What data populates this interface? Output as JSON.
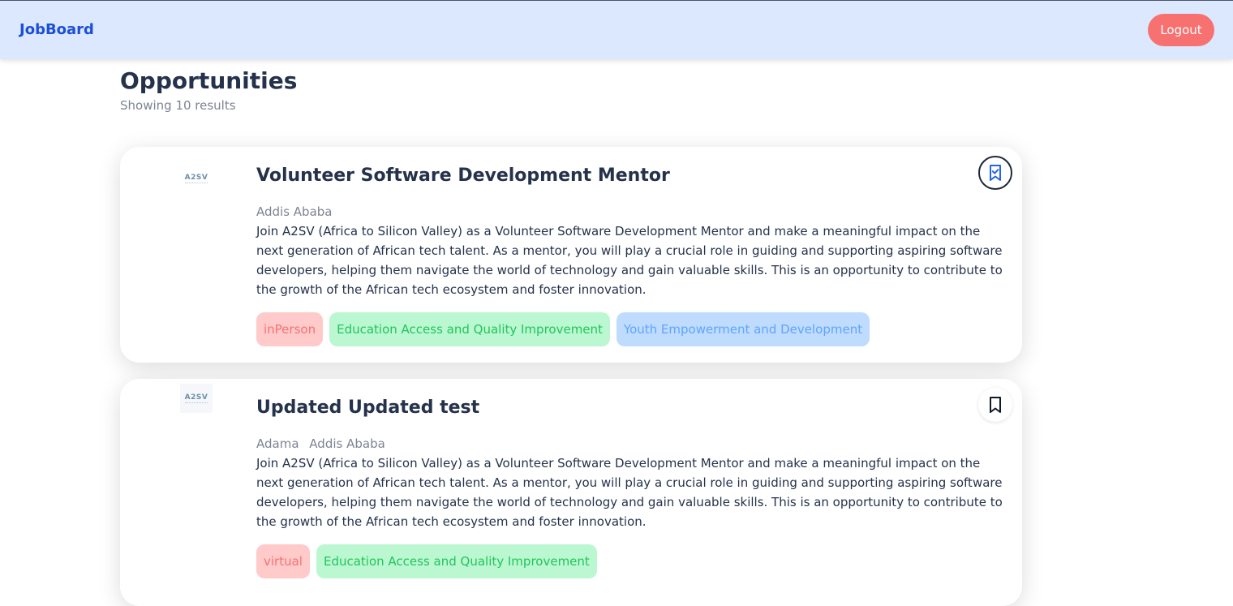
{
  "navbar": {
    "brand": "JobBoard",
    "logout_label": "Logout"
  },
  "page": {
    "title": "Opportunities",
    "result_count": "Showing 10 results"
  },
  "colors": {
    "navbar_bg": "#dbe8fe",
    "brand": "#1d4ed8",
    "logout_bg": "#f87171",
    "tag_red": "#f87171",
    "tag_green": "#22c55e",
    "tag_blue": "#60a5fa"
  },
  "jobs": [
    {
      "logo_text": "A2SV",
      "title": "Volunteer Software Development Mentor",
      "locations": [
        "Addis Ababa"
      ],
      "description": "Join A2SV (Africa to Silicon Valley) as a Volunteer Software Development Mentor and make a meaningful impact on the next generation of African tech talent. As a mentor, you will play a crucial role in guiding and supporting aspiring software developers, helping them navigate the world of technology and gain valuable skills. This is an opportunity to contribute to the growth of the African tech ecosystem and foster innovation.",
      "tags": [
        "inPerson",
        "Education Access and Quality Improvement",
        "Youth Empowerment and Development"
      ],
      "bookmark_icon": "bookmark-check-icon",
      "bookmarked": true
    },
    {
      "logo_text": "A2SV",
      "title": "Updated Updated test",
      "locations": [
        "Adama",
        "Addis Ababa"
      ],
      "description": "Join A2SV (Africa to Silicon Valley) as a Volunteer Software Development Mentor and make a meaningful impact on the next generation of African tech talent. As a mentor, you will play a crucial role in guiding and supporting aspiring software developers, helping them navigate the world of technology and gain valuable skills. This is an opportunity to contribute to the growth of the African tech ecosystem and foster innovation.",
      "tags": [
        "virtual",
        "Education Access and Quality Improvement"
      ],
      "bookmark_icon": "bookmark-icon",
      "bookmarked": false
    }
  ]
}
